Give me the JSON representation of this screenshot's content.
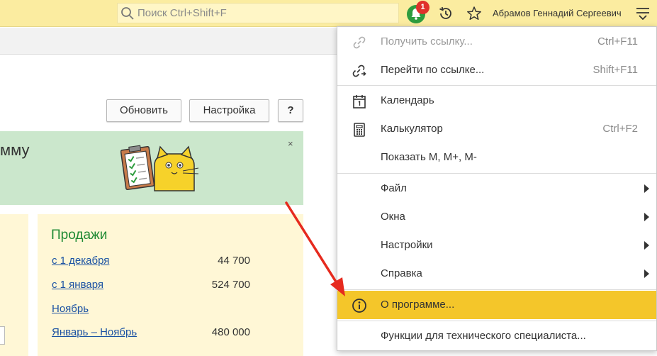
{
  "topbar": {
    "search_placeholder": "Поиск Ctrl+Shift+F",
    "notification_count": "1",
    "user_name": "Абрамов Геннадий Сергеевич"
  },
  "toolbar": {
    "refresh_label": "Обновить",
    "settings_label": "Настройка",
    "help_label": "?"
  },
  "banner": {
    "text": "мму",
    "close_label": "×",
    "bg_color": "#cbe7cc"
  },
  "sales": {
    "title": "Продажи",
    "rows": [
      {
        "label": "с 1 декабря",
        "value": "44 700"
      },
      {
        "label": "с 1 января",
        "value": "524 700"
      },
      {
        "label": "Ноябрь",
        "value": ""
      },
      {
        "label": "Январь – Ноябрь",
        "value": "480 000"
      }
    ]
  },
  "menu": {
    "items": [
      {
        "label": "Получить ссылку...",
        "shortcut": "Ctrl+F11",
        "icon": "link-icon",
        "disabled": true
      },
      {
        "label": "Перейти по ссылке...",
        "shortcut": "Shift+F11",
        "icon": "go-to-link-icon"
      },
      {
        "label": "Календарь",
        "shortcut": "",
        "icon": "calendar-icon"
      },
      {
        "label": "Калькулятор",
        "shortcut": "Ctrl+F2",
        "icon": "calculator-icon"
      },
      {
        "label": "Показать М, М+, М-",
        "shortcut": ""
      },
      {
        "label": "Файл",
        "submenu": true
      },
      {
        "label": "Окна",
        "submenu": true
      },
      {
        "label": "Настройки",
        "submenu": true
      },
      {
        "label": "Справка",
        "submenu": true
      },
      {
        "label": "О программе...",
        "icon": "info-icon",
        "highlighted": true
      },
      {
        "label": "Функции для технического специалиста..."
      }
    ],
    "highlight_color": "#f4c62a"
  },
  "colors": {
    "topbar_bg": "#fbeca0",
    "accent_green": "#1f8a34",
    "link_blue": "#1c52a3",
    "badge_red": "#e0312b",
    "annotation_arrow": "#e62a1e"
  }
}
